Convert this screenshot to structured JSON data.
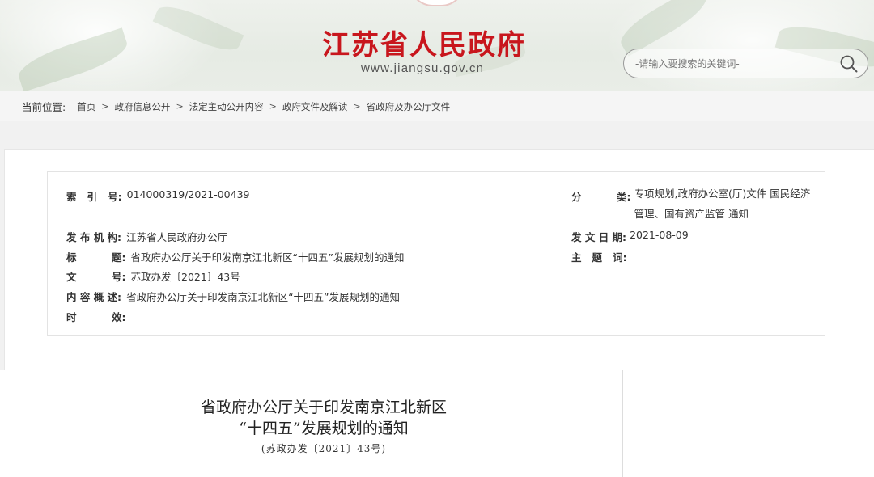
{
  "header": {
    "site_title": "江苏省人民政府",
    "site_domain": "www.jiangsu.gov.cn",
    "search_placeholder": "-请输入要搜索的关键词-"
  },
  "breadcrumb": {
    "label": "当前位置:",
    "items": [
      "首页",
      "政府信息公开",
      "法定主动公开内容",
      "政府文件及解读",
      "省政府及办公厅文件"
    ],
    "separator": ">"
  },
  "metadata": {
    "index_no": {
      "label": "索   引   号:",
      "value": "014000319/2021-00439"
    },
    "category": {
      "label": "分          类:",
      "value": "专项规划,政府办公室(厅)文件 国民经济管理、国有资产监管 通知"
    },
    "issuer": {
      "label": "发 布 机 构:",
      "value": "江苏省人民政府办公厅"
    },
    "issue_date": {
      "label": "发 文 日 期:",
      "value": "2021-08-09"
    },
    "title": {
      "label": "标          题:",
      "value": "省政府办公厅关于印发南京江北新区“十四五”发展规划的通知"
    },
    "keywords": {
      "label": "主   题   词:",
      "value": ""
    },
    "doc_no": {
      "label": "文          号:",
      "value": "苏政办发〔2021〕43号"
    },
    "summary": {
      "label": "内 容 概 述:",
      "value": "省政府办公厅关于印发南京江北新区“十四五”发展规划的通知"
    },
    "validity": {
      "label": "时          效:",
      "value": ""
    }
  },
  "document": {
    "title_line1": "省政府办公厅关于印发南京江北新区",
    "title_line2": "“十四五”发展规划的通知",
    "doc_number": "(苏政办发〔2021〕43号)"
  },
  "colors": {
    "brand_red": "#c8161d",
    "page_bg": "#f1f1f1"
  },
  "icons": [
    "search-icon",
    "emblem-icon"
  ]
}
